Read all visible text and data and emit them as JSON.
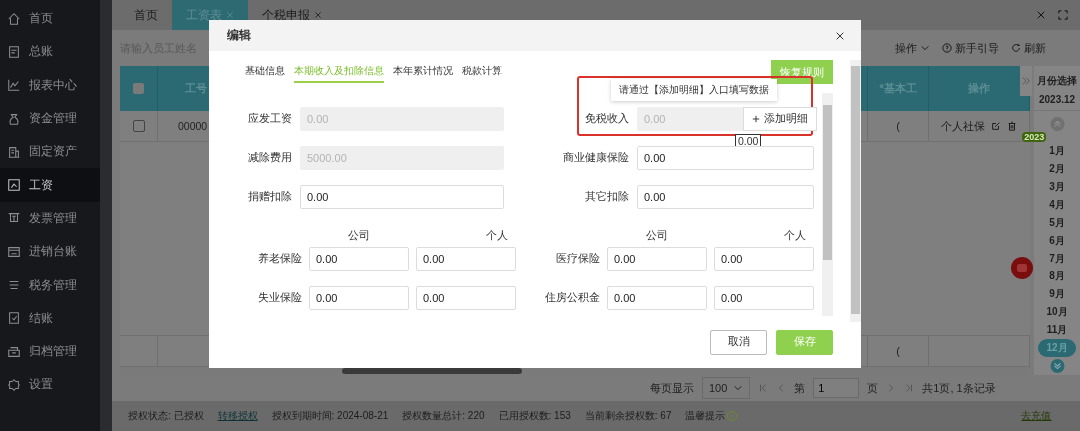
{
  "sidebar": {
    "items": [
      {
        "label": "首页",
        "selected": false
      },
      {
        "label": "总账",
        "selected": false
      },
      {
        "label": "报表中心",
        "selected": false
      },
      {
        "label": "资金管理",
        "selected": false
      },
      {
        "label": "固定资产",
        "selected": false
      },
      {
        "label": "工资",
        "selected": true
      },
      {
        "label": "发票管理",
        "selected": false
      },
      {
        "label": "进销台账",
        "selected": false
      },
      {
        "label": "税务管理",
        "selected": false
      },
      {
        "label": "结账",
        "selected": false
      },
      {
        "label": "归档管理",
        "selected": false
      },
      {
        "label": "设置",
        "selected": false
      }
    ]
  },
  "tabs": [
    {
      "label": "首页",
      "closable": false,
      "selected": false
    },
    {
      "label": "工资表",
      "closable": true,
      "selected": true
    },
    {
      "label": "个税申报",
      "closable": true,
      "selected": false
    }
  ],
  "toolbar": {
    "search": {
      "placeholder": "请输入员工姓名"
    },
    "actions": [
      {
        "label": "操作",
        "kind": "dropdown"
      },
      {
        "label": "新手引导",
        "kind": "help"
      },
      {
        "label": "刷新",
        "kind": "refresh"
      }
    ]
  },
  "table": {
    "all_checked": false,
    "columns": [
      "工号",
      "*基本工",
      "操作"
    ],
    "rows": [
      {
        "checked": false,
        "cells": [
          "00000",
          "(",
          "个人社保"
        ]
      }
    ],
    "summary_row": [
      "("
    ]
  },
  "pagination": {
    "page_size_label": "每页显示",
    "page_size": "100",
    "page_prefix": "第",
    "page": "1",
    "page_suffix": "页",
    "summary": "共1页, 1条记录"
  },
  "month_panel": {
    "title": "月份选择",
    "current": "2023.12",
    "year_badge": "2023",
    "months": [
      {
        "label": "1月",
        "selected": false
      },
      {
        "label": "2月",
        "selected": false
      },
      {
        "label": "3月",
        "selected": false
      },
      {
        "label": "4月",
        "selected": false
      },
      {
        "label": "5月",
        "selected": false
      },
      {
        "label": "6月",
        "selected": false
      },
      {
        "label": "7月",
        "selected": false
      },
      {
        "label": "8月",
        "selected": false
      },
      {
        "label": "9月",
        "selected": false
      },
      {
        "label": "10月",
        "selected": false
      },
      {
        "label": "11月",
        "selected": false
      },
      {
        "label": "12月",
        "selected": true
      }
    ]
  },
  "status_bar": [
    {
      "text": "授权状态: 已授权",
      "kind": "text"
    },
    {
      "text": "转移授权",
      "kind": "link"
    },
    {
      "text": "授权到期时间: 2024-08-21",
      "kind": "text"
    },
    {
      "text": "授权数量总计: 220",
      "kind": "text"
    },
    {
      "text": "已用授权数: 153",
      "kind": "text"
    },
    {
      "text": "当前剩余授权数: 67",
      "kind": "text"
    },
    {
      "text": "温馨提示",
      "kind": "info"
    },
    {
      "text": "去充值",
      "kind": "link"
    }
  ],
  "dialog": {
    "title": "编辑",
    "tabs": [
      {
        "label": "基础信息",
        "selected": false
      },
      {
        "label": "本期收入及扣除信息",
        "selected": true
      },
      {
        "label": "本年累计情况",
        "selected": false
      },
      {
        "label": "税款计算",
        "selected": false
      }
    ],
    "restore_button": "恢复规则",
    "fields": [
      {
        "label": "应发工资",
        "value": "0.00",
        "disabled": true,
        "annotated": false
      },
      {
        "label": "免税收入",
        "value": "0.00",
        "disabled": true,
        "annotated": true,
        "action": "添加明细",
        "tooltip": "请通过【添加明细】入口填写数据",
        "hint": "0.00"
      },
      {
        "label": "减除费用",
        "value": "5000.00",
        "disabled": true,
        "annotated": false
      },
      {
        "label": "商业健康保险",
        "value": "0.00",
        "disabled": false,
        "annotated": false
      },
      {
        "label": "捐赠扣除",
        "value": "0.00",
        "disabled": false,
        "annotated": false
      },
      {
        "label": "其它扣除",
        "value": "0.00",
        "disabled": false,
        "annotated": false
      }
    ],
    "insurance": {
      "column_headers": [
        "公司",
        "个人",
        "公司",
        "个人"
      ],
      "rows": [
        {
          "label": "养老保险",
          "company": "0.00",
          "personal": "0.00"
        },
        {
          "label": "医疗保险",
          "company": "0.00",
          "personal": "0.00"
        },
        {
          "label": "失业保险",
          "company": "0.00",
          "personal": "0.00"
        },
        {
          "label": "住房公积金",
          "company": "0.00",
          "personal": "0.00"
        }
      ]
    },
    "buttons": [
      {
        "label": "取消",
        "kind": "secondary"
      },
      {
        "label": "保存",
        "kind": "primary"
      }
    ]
  }
}
